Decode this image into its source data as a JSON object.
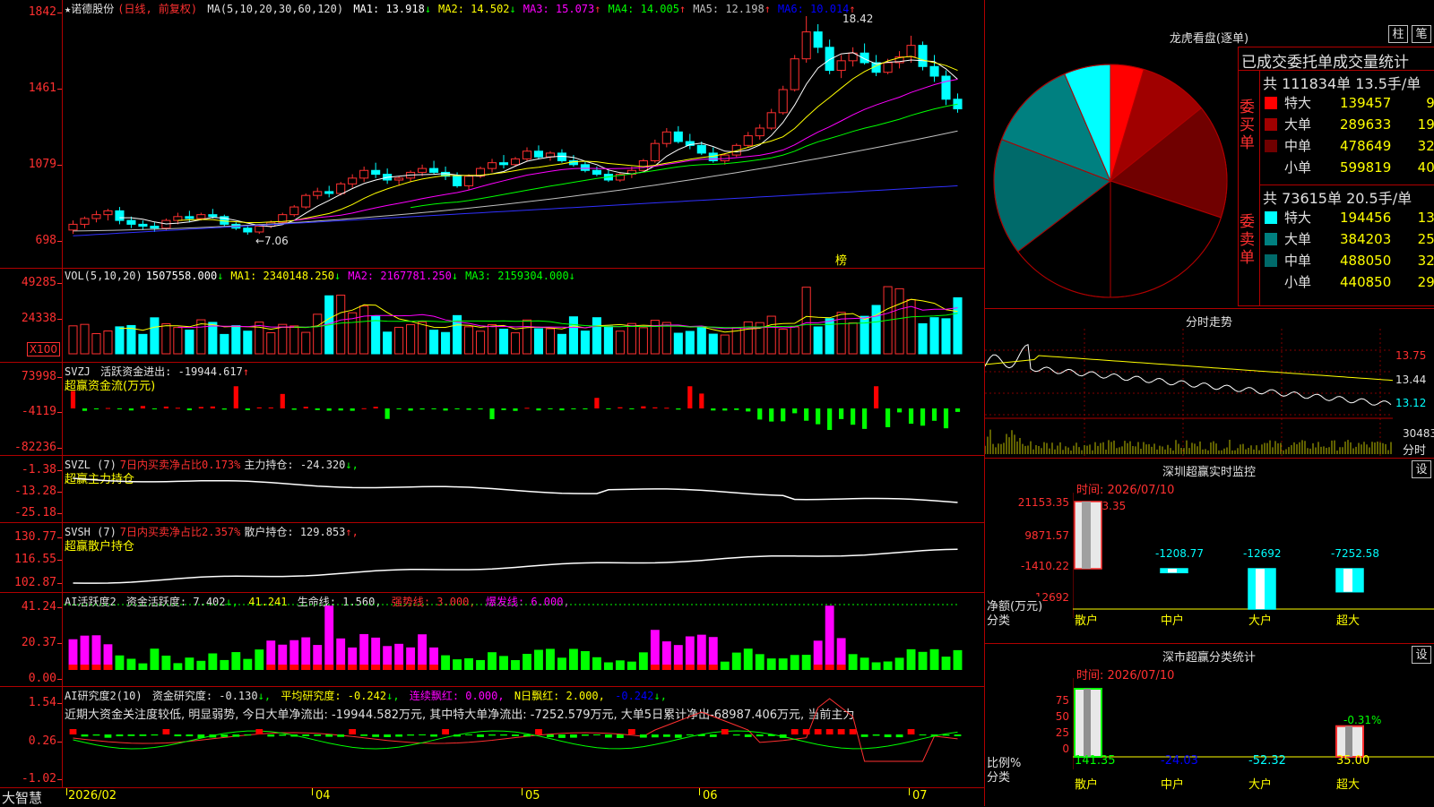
{
  "stock": {
    "name": "★诺德股份",
    "period": "(日线, 前复权)"
  },
  "kline": {
    "ma_header": "MA(5,10,20,30,60,120)",
    "ma": [
      {
        "label": "MA1: 13.918",
        "arrow": "↓",
        "color": "#ffffff"
      },
      {
        "label": "MA2: 14.502",
        "arrow": "↓",
        "color": "#ffff00"
      },
      {
        "label": "MA3: 15.073",
        "arrow": "↑",
        "color": "#ff00ff"
      },
      {
        "label": "MA4: 14.005",
        "arrow": "↑",
        "color": "#00ff00"
      },
      {
        "label": "MA5: 12.198",
        "arrow": "↑",
        "color": "#c0c0c0"
      },
      {
        "label": "MA6: 10.014",
        "arrow": "↑",
        "color": "#0000ff"
      }
    ],
    "y_labels": [
      "1842",
      "1461",
      "1079",
      "698"
    ],
    "high_note": "18.42",
    "low_note": "←7.06",
    "bang": "榜",
    "candles": [
      [
        7.3,
        7.8,
        7.1,
        7.6
      ],
      [
        7.6,
        8.0,
        7.4,
        7.9
      ],
      [
        7.9,
        8.3,
        7.7,
        8.1
      ],
      [
        8.1,
        8.4,
        7.8,
        8.3
      ],
      [
        8.3,
        8.5,
        7.6,
        7.8
      ],
      [
        7.8,
        8.0,
        7.4,
        7.6
      ],
      [
        7.6,
        7.8,
        7.3,
        7.5
      ],
      [
        7.5,
        7.7,
        7.2,
        7.4
      ],
      [
        7.4,
        7.9,
        7.3,
        7.8
      ],
      [
        7.8,
        8.2,
        7.6,
        8.0
      ],
      [
        8.0,
        8.3,
        7.7,
        7.9
      ],
      [
        7.9,
        8.2,
        7.8,
        8.1
      ],
      [
        8.1,
        8.4,
        7.9,
        8.0
      ],
      [
        8.0,
        8.1,
        7.5,
        7.6
      ],
      [
        7.6,
        7.7,
        7.3,
        7.4
      ],
      [
        7.4,
        7.5,
        7.06,
        7.2
      ],
      [
        7.2,
        7.6,
        7.1,
        7.5
      ],
      [
        7.5,
        7.8,
        7.4,
        7.7
      ],
      [
        7.7,
        8.2,
        7.6,
        8.1
      ],
      [
        8.1,
        8.6,
        8.0,
        8.5
      ],
      [
        8.5,
        9.2,
        8.4,
        9.1
      ],
      [
        9.1,
        9.5,
        8.9,
        9.3
      ],
      [
        9.3,
        9.6,
        9.0,
        9.2
      ],
      [
        9.2,
        9.8,
        9.1,
        9.7
      ],
      [
        9.7,
        10.2,
        9.5,
        10.0
      ],
      [
        10.0,
        10.6,
        9.8,
        10.4
      ],
      [
        10.4,
        10.8,
        10.0,
        10.2
      ],
      [
        10.2,
        10.5,
        9.7,
        9.9
      ],
      [
        9.9,
        10.1,
        9.6,
        10.0
      ],
      [
        10.0,
        10.4,
        9.8,
        10.3
      ],
      [
        10.3,
        10.7,
        10.1,
        10.5
      ],
      [
        10.5,
        10.9,
        10.2,
        10.3
      ],
      [
        10.3,
        10.6,
        9.9,
        10.1
      ],
      [
        10.1,
        10.3,
        9.5,
        9.6
      ],
      [
        9.6,
        10.2,
        9.4,
        10.1
      ],
      [
        10.1,
        10.6,
        10.0,
        10.5
      ],
      [
        10.5,
        11.0,
        10.3,
        10.8
      ],
      [
        10.8,
        11.2,
        10.5,
        10.7
      ],
      [
        10.7,
        11.1,
        10.6,
        11.0
      ],
      [
        11.0,
        11.6,
        10.9,
        11.4
      ],
      [
        11.4,
        11.7,
        11.0,
        11.1
      ],
      [
        11.1,
        11.4,
        10.9,
        11.3
      ],
      [
        11.3,
        11.5,
        10.8,
        10.9
      ],
      [
        10.9,
        11.2,
        10.6,
        10.7
      ],
      [
        10.7,
        10.9,
        10.3,
        10.4
      ],
      [
        10.4,
        10.6,
        10.1,
        10.2
      ],
      [
        10.2,
        10.4,
        9.8,
        9.9
      ],
      [
        9.9,
        10.3,
        9.8,
        10.2
      ],
      [
        10.2,
        10.6,
        10.0,
        10.4
      ],
      [
        10.4,
        11.0,
        10.3,
        10.9
      ],
      [
        10.9,
        12.0,
        10.8,
        11.8
      ],
      [
        11.8,
        12.6,
        11.6,
        12.4
      ],
      [
        12.4,
        12.7,
        11.8,
        11.9
      ],
      [
        11.9,
        12.3,
        11.5,
        11.7
      ],
      [
        11.7,
        11.9,
        11.2,
        11.3
      ],
      [
        11.3,
        11.6,
        10.8,
        10.9
      ],
      [
        10.9,
        11.3,
        10.7,
        11.2
      ],
      [
        11.2,
        11.8,
        11.1,
        11.7
      ],
      [
        11.7,
        12.4,
        11.6,
        12.2
      ],
      [
        12.2,
        12.8,
        12.0,
        12.6
      ],
      [
        12.6,
        13.6,
        12.5,
        13.4
      ],
      [
        13.4,
        14.8,
        13.3,
        14.6
      ],
      [
        14.6,
        16.4,
        14.5,
        16.2
      ],
      [
        16.2,
        18.42,
        16.0,
        17.6
      ],
      [
        17.6,
        18.0,
        16.5,
        16.8
      ],
      [
        16.8,
        17.2,
        15.4,
        15.6
      ],
      [
        15.6,
        16.4,
        15.2,
        16.1
      ],
      [
        16.1,
        16.8,
        15.8,
        16.5
      ],
      [
        16.5,
        17.0,
        15.9,
        16.0
      ],
      [
        16.0,
        16.4,
        15.3,
        15.5
      ],
      [
        15.5,
        16.2,
        15.4,
        16.0
      ],
      [
        16.0,
        16.6,
        15.7,
        16.3
      ],
      [
        16.3,
        17.4,
        16.0,
        16.9
      ],
      [
        16.9,
        17.1,
        15.6,
        15.8
      ],
      [
        15.8,
        16.4,
        15.0,
        15.3
      ],
      [
        15.3,
        15.6,
        13.8,
        14.1
      ],
      [
        14.1,
        14.4,
        13.4,
        13.6
      ]
    ]
  },
  "vol": {
    "header": "VOL(5,10,20)",
    "items": [
      {
        "label": "1507558.000",
        "arrow": "↓",
        "color": "#ffffff"
      },
      {
        "label": "MA1: 2340148.250",
        "arrow": "↓",
        "color": "#ffff00"
      },
      {
        "label": "MA2: 2167781.250",
        "arrow": "↓",
        "color": "#ff00ff"
      },
      {
        "label": "MA3: 2159304.000",
        "arrow": "↓",
        "color": "#00ff00"
      }
    ],
    "y_labels": [
      "49285",
      "24338"
    ],
    "unit": "X100"
  },
  "svzj": {
    "name": "SVZJ",
    "text": "活跃资金进出: -19944.617",
    "arrow": "↑",
    "sub": "超赢资金流(万元)",
    "y_labels": [
      "73998",
      "-4119",
      "-82236"
    ]
  },
  "svzl": {
    "name": "SVZL (7)",
    "pct": "7日内买卖净占比0.173%",
    "text": "主力持仓: -24.320",
    "arrow": "↓,",
    "sub": "超赢主力持仓",
    "y_labels": [
      "-1.38",
      "-13.28",
      "-25.18"
    ]
  },
  "svsh": {
    "name": "SVSH (7)",
    "pct": "7日内买卖净占比2.357%",
    "text": "散户持仓: 129.853",
    "arrow": "↑,",
    "sub": "超赢散户持仓",
    "y_labels": [
      "130.77",
      "116.55",
      "102.87"
    ]
  },
  "ai2": {
    "name": "AI活跃度2",
    "a": "资金活跃度: 7.402",
    "a_arrow": "↓,",
    "b": "41.241",
    "c": "生命线: 1.560,",
    "d": "强势线: 3.000,",
    "e": "爆发线: 6.000,",
    "y_labels": [
      "41.24",
      "20.37",
      "0.00"
    ]
  },
  "ai_res": {
    "name": "AI研究度2(10)",
    "a": "资金研究度: -0.130",
    "a_arrow": "↓,",
    "b": "平均研究度: -0.242",
    "b_arrow": "↓,",
    "c": "连续飘红: 0.000,",
    "d": "N日飘红: 2.000,",
    "e": "-0.242",
    "e_arrow": "↓,",
    "desc": "近期大资金关注度较低, 明显弱势, 今日大单净流出: -19944.582万元, 其中特大单净流出: -7252.579万元, 大单5日累计净出-68987.406万元, 当前主力",
    "y_labels": [
      "1.54",
      "0.26",
      "-1.02"
    ]
  },
  "xaxis": {
    "brand": "大智慧",
    "labels": [
      "2026/02",
      "04",
      "05",
      "06",
      "07"
    ]
  },
  "dragon": {
    "title": "龙虎看盘(逐单)",
    "btn1": "柱",
    "btn2": "笔",
    "stat_title": "已成交委托单成交量统计",
    "buy": {
      "side": "委买单",
      "total": "共 111834单 13.5手/单",
      "rows": [
        {
          "name": "特大",
          "value": "139457",
          "pct": "9%",
          "color": "#ff0000"
        },
        {
          "name": "大单",
          "value": "289633",
          "pct": "19%",
          "color": "#a00000"
        },
        {
          "name": "中单",
          "value": "478649",
          "pct": "32%",
          "color": "#700000"
        },
        {
          "name": "小单",
          "value": "599819",
          "pct": "40%",
          "color": "#000000"
        }
      ]
    },
    "sell": {
      "side": "委卖单",
      "total": "共 73615单 20.5手/单",
      "rows": [
        {
          "name": "特大",
          "value": "194456",
          "pct": "13%",
          "color": "#00ffff"
        },
        {
          "name": "大单",
          "value": "384203",
          "pct": "25%",
          "color": "#008080"
        },
        {
          "name": "中单",
          "value": "488050",
          "pct": "32%",
          "color": "#006a6a"
        },
        {
          "name": "小单",
          "value": "440850",
          "pct": "29%",
          "color": "#000000"
        }
      ]
    }
  },
  "minute": {
    "title": "分时走势",
    "y_labels": [
      "13.75",
      "13.44",
      "13.12"
    ],
    "vol_label": "30483",
    "x_label": "分时"
  },
  "monitor": {
    "title": "深圳超赢实时监控",
    "btn": "设",
    "date": "时间: 2026/07/10",
    "y_labels": [
      "21153.35",
      "9871.57",
      "-1410.22",
      "-12692"
    ],
    "top_val": "21153.35",
    "axis_label": "净额(万元)",
    "cat_label": "分类",
    "cats": [
      "散户",
      "中户",
      "大户",
      "超大"
    ],
    "vals": [
      "21153.35",
      "-1208.77",
      "-12692",
      "-7252.58"
    ],
    "nums": [
      21153.35,
      -1208.77,
      -12692,
      -7252.58
    ]
  },
  "classify": {
    "title": "深市超赢分类统计",
    "btn": "设",
    "date": "时间: 2026/07/10",
    "y_labels": [
      "75",
      "50",
      "25",
      "0"
    ],
    "axis_label": "比例%",
    "cat_label": "分类",
    "cats": [
      "散户",
      "中户",
      "大户",
      "超大"
    ],
    "vals": [
      "141.35",
      "-24.03",
      "-52.32",
      "35.00"
    ],
    "nums": [
      141.35,
      -24.03,
      -52.32,
      35.0
    ],
    "note": "-0.31%"
  },
  "colors": {
    "up": "#ff3030",
    "down": "#00ffff",
    "grid": "#b00000"
  }
}
